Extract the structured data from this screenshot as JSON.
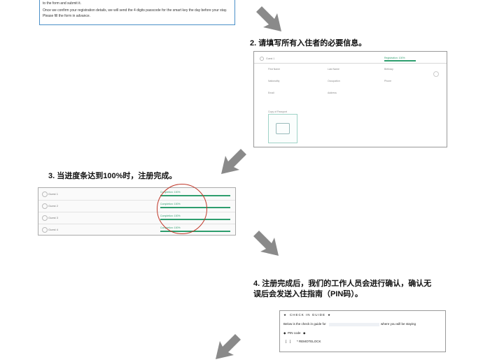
{
  "top_shot": {
    "line1": "to the form and submit it.",
    "line2": "Once we confirm your registration details, we will send the 4 digits passcode for the smart key the day before your stay.",
    "line3": "Please fill the form in advance."
  },
  "steps": {
    "step2": "2. 请填写所有入住者的必要信息。",
    "step3": "3. 当进度条达到100%时，注册完成。",
    "step4_line1": "4. 注册完成后，我们的工作人员会进行确认，确认无",
    "step4_line2": "误后会发送入住指南（PIN码）。"
  },
  "form": {
    "guest_tab": "Guest 1",
    "progress": "Registration: 100%",
    "fields": [
      "First Name",
      "Last Name",
      "Birthday",
      "Nationality",
      "Occupation",
      "Phone",
      "Email",
      "Address"
    ],
    "upload_label": "Copy of Passport"
  },
  "guests": {
    "progress_label": "Completion: 100%",
    "rows": [
      {
        "name": "Guest 1"
      },
      {
        "name": "Guest 2"
      },
      {
        "name": "Guest 3"
      },
      {
        "name": "Guest 4"
      }
    ]
  },
  "guide": {
    "title": "CHECK IN GUIDE",
    "line_pre": "Below is the check in guide for",
    "line_post": "where you will be staying",
    "pin_label": "PIN code",
    "pin_value": "* REMOTELOCK"
  },
  "colors": {
    "accent": "#2e9e6e",
    "circle": "#c0392b",
    "arrow": "#8a8a8a",
    "frame": "#4a90c8"
  }
}
